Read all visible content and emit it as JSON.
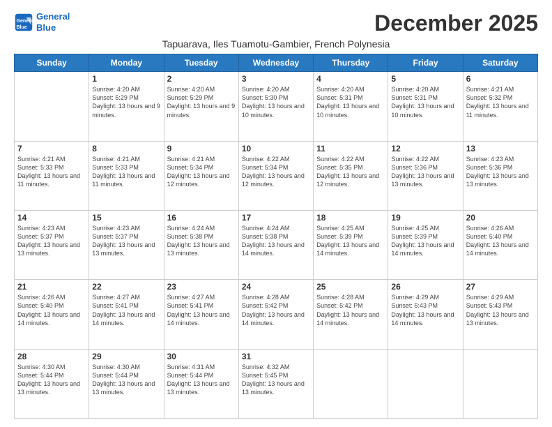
{
  "logo": {
    "line1": "General",
    "line2": "Blue"
  },
  "title": "December 2025",
  "subtitle": "Tapuarava, Iles Tuamotu-Gambier, French Polynesia",
  "days_of_week": [
    "Sunday",
    "Monday",
    "Tuesday",
    "Wednesday",
    "Thursday",
    "Friday",
    "Saturday"
  ],
  "weeks": [
    [
      {
        "day": "",
        "sunrise": "",
        "sunset": "",
        "daylight": ""
      },
      {
        "day": "1",
        "sunrise": "Sunrise: 4:20 AM",
        "sunset": "Sunset: 5:29 PM",
        "daylight": "Daylight: 13 hours and 9 minutes."
      },
      {
        "day": "2",
        "sunrise": "Sunrise: 4:20 AM",
        "sunset": "Sunset: 5:29 PM",
        "daylight": "Daylight: 13 hours and 9 minutes."
      },
      {
        "day": "3",
        "sunrise": "Sunrise: 4:20 AM",
        "sunset": "Sunset: 5:30 PM",
        "daylight": "Daylight: 13 hours and 10 minutes."
      },
      {
        "day": "4",
        "sunrise": "Sunrise: 4:20 AM",
        "sunset": "Sunset: 5:31 PM",
        "daylight": "Daylight: 13 hours and 10 minutes."
      },
      {
        "day": "5",
        "sunrise": "Sunrise: 4:20 AM",
        "sunset": "Sunset: 5:31 PM",
        "daylight": "Daylight: 13 hours and 10 minutes."
      },
      {
        "day": "6",
        "sunrise": "Sunrise: 4:21 AM",
        "sunset": "Sunset: 5:32 PM",
        "daylight": "Daylight: 13 hours and 11 minutes."
      }
    ],
    [
      {
        "day": "7",
        "sunrise": "Sunrise: 4:21 AM",
        "sunset": "Sunset: 5:33 PM",
        "daylight": "Daylight: 13 hours and 11 minutes."
      },
      {
        "day": "8",
        "sunrise": "Sunrise: 4:21 AM",
        "sunset": "Sunset: 5:33 PM",
        "daylight": "Daylight: 13 hours and 11 minutes."
      },
      {
        "day": "9",
        "sunrise": "Sunrise: 4:21 AM",
        "sunset": "Sunset: 5:34 PM",
        "daylight": "Daylight: 13 hours and 12 minutes."
      },
      {
        "day": "10",
        "sunrise": "Sunrise: 4:22 AM",
        "sunset": "Sunset: 5:34 PM",
        "daylight": "Daylight: 13 hours and 12 minutes."
      },
      {
        "day": "11",
        "sunrise": "Sunrise: 4:22 AM",
        "sunset": "Sunset: 5:35 PM",
        "daylight": "Daylight: 13 hours and 12 minutes."
      },
      {
        "day": "12",
        "sunrise": "Sunrise: 4:22 AM",
        "sunset": "Sunset: 5:36 PM",
        "daylight": "Daylight: 13 hours and 13 minutes."
      },
      {
        "day": "13",
        "sunrise": "Sunrise: 4:23 AM",
        "sunset": "Sunset: 5:36 PM",
        "daylight": "Daylight: 13 hours and 13 minutes."
      }
    ],
    [
      {
        "day": "14",
        "sunrise": "Sunrise: 4:23 AM",
        "sunset": "Sunset: 5:37 PM",
        "daylight": "Daylight: 13 hours and 13 minutes."
      },
      {
        "day": "15",
        "sunrise": "Sunrise: 4:23 AM",
        "sunset": "Sunset: 5:37 PM",
        "daylight": "Daylight: 13 hours and 13 minutes."
      },
      {
        "day": "16",
        "sunrise": "Sunrise: 4:24 AM",
        "sunset": "Sunset: 5:38 PM",
        "daylight": "Daylight: 13 hours and 13 minutes."
      },
      {
        "day": "17",
        "sunrise": "Sunrise: 4:24 AM",
        "sunset": "Sunset: 5:38 PM",
        "daylight": "Daylight: 13 hours and 14 minutes."
      },
      {
        "day": "18",
        "sunrise": "Sunrise: 4:25 AM",
        "sunset": "Sunset: 5:39 PM",
        "daylight": "Daylight: 13 hours and 14 minutes."
      },
      {
        "day": "19",
        "sunrise": "Sunrise: 4:25 AM",
        "sunset": "Sunset: 5:39 PM",
        "daylight": "Daylight: 13 hours and 14 minutes."
      },
      {
        "day": "20",
        "sunrise": "Sunrise: 4:26 AM",
        "sunset": "Sunset: 5:40 PM",
        "daylight": "Daylight: 13 hours and 14 minutes."
      }
    ],
    [
      {
        "day": "21",
        "sunrise": "Sunrise: 4:26 AM",
        "sunset": "Sunset: 5:40 PM",
        "daylight": "Daylight: 13 hours and 14 minutes."
      },
      {
        "day": "22",
        "sunrise": "Sunrise: 4:27 AM",
        "sunset": "Sunset: 5:41 PM",
        "daylight": "Daylight: 13 hours and 14 minutes."
      },
      {
        "day": "23",
        "sunrise": "Sunrise: 4:27 AM",
        "sunset": "Sunset: 5:41 PM",
        "daylight": "Daylight: 13 hours and 14 minutes."
      },
      {
        "day": "24",
        "sunrise": "Sunrise: 4:28 AM",
        "sunset": "Sunset: 5:42 PM",
        "daylight": "Daylight: 13 hours and 14 minutes."
      },
      {
        "day": "25",
        "sunrise": "Sunrise: 4:28 AM",
        "sunset": "Sunset: 5:42 PM",
        "daylight": "Daylight: 13 hours and 14 minutes."
      },
      {
        "day": "26",
        "sunrise": "Sunrise: 4:29 AM",
        "sunset": "Sunset: 5:43 PM",
        "daylight": "Daylight: 13 hours and 14 minutes."
      },
      {
        "day": "27",
        "sunrise": "Sunrise: 4:29 AM",
        "sunset": "Sunset: 5:43 PM",
        "daylight": "Daylight: 13 hours and 13 minutes."
      }
    ],
    [
      {
        "day": "28",
        "sunrise": "Sunrise: 4:30 AM",
        "sunset": "Sunset: 5:44 PM",
        "daylight": "Daylight: 13 hours and 13 minutes."
      },
      {
        "day": "29",
        "sunrise": "Sunrise: 4:30 AM",
        "sunset": "Sunset: 5:44 PM",
        "daylight": "Daylight: 13 hours and 13 minutes."
      },
      {
        "day": "30",
        "sunrise": "Sunrise: 4:31 AM",
        "sunset": "Sunset: 5:44 PM",
        "daylight": "Daylight: 13 hours and 13 minutes."
      },
      {
        "day": "31",
        "sunrise": "Sunrise: 4:32 AM",
        "sunset": "Sunset: 5:45 PM",
        "daylight": "Daylight: 13 hours and 13 minutes."
      },
      {
        "day": "",
        "sunrise": "",
        "sunset": "",
        "daylight": ""
      },
      {
        "day": "",
        "sunrise": "",
        "sunset": "",
        "daylight": ""
      },
      {
        "day": "",
        "sunrise": "",
        "sunset": "",
        "daylight": ""
      }
    ]
  ]
}
